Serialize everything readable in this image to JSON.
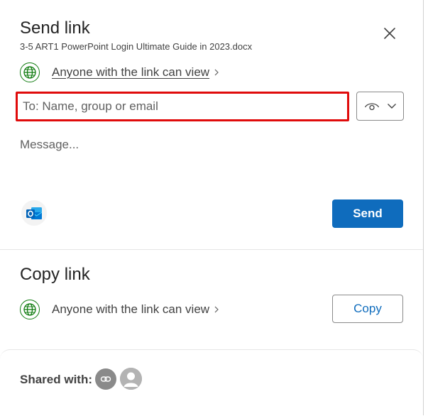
{
  "send_section": {
    "title": "Send link",
    "filename": "3-5 ART1 PowerPoint Login Ultimate Guide in 2023.docx",
    "permission_text": "Anyone with the link can view",
    "to_placeholder": "To: Name, group or email",
    "message_placeholder": "Message...",
    "send_label": "Send"
  },
  "copy_section": {
    "title": "Copy link",
    "permission_text": "Anyone with the link can view",
    "copy_label": "Copy"
  },
  "shared_section": {
    "label": "Shared with:"
  },
  "icons": {
    "close": "close-icon",
    "globe": "globe-icon",
    "eye": "eye-icon",
    "chevron": "chevron-down-icon",
    "outlook": "outlook-icon",
    "link": "link-icon",
    "person": "person-icon"
  },
  "colors": {
    "accent": "#0f6cbd",
    "highlight_border": "#e00b0b",
    "globe_green": "#107c10"
  }
}
